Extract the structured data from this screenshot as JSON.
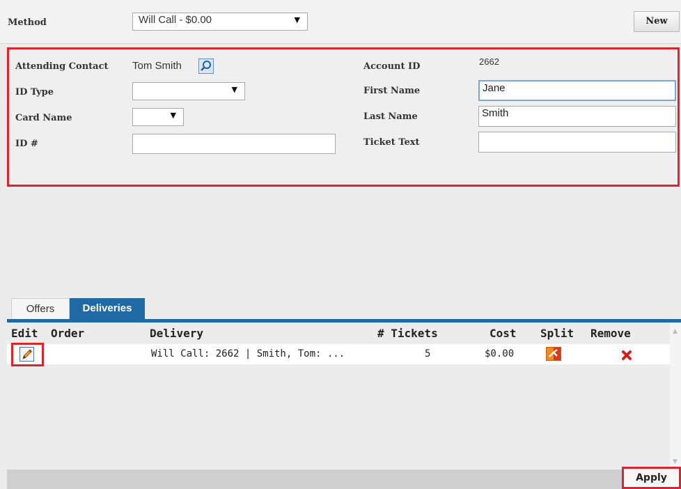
{
  "method_bar": {
    "label": "Method",
    "select_value": "Will Call - $0.00",
    "new_button": "New"
  },
  "contact": {
    "attending_contact_label": "Attending Contact",
    "attending_contact_value": "Tom Smith",
    "id_type_label": "ID Type",
    "id_type_value": "",
    "card_name_label": "Card Name",
    "card_name_value": "",
    "id_number_label": "ID #",
    "id_number_value": "",
    "account_id_label": "Account ID",
    "account_id_value": "2662",
    "first_name_label": "First Name",
    "first_name_value": "Jane",
    "last_name_label": "Last Name",
    "last_name_value": "Smith",
    "ticket_text_label": "Ticket Text",
    "ticket_text_value": ""
  },
  "tabs": [
    {
      "label": "Offers",
      "active": false
    },
    {
      "label": "Deliveries",
      "active": true
    }
  ],
  "grid": {
    "columns": [
      "Edit",
      "Order",
      "Delivery",
      "# Tickets",
      "Cost",
      "Split",
      "Remove"
    ],
    "rows": [
      {
        "order": "",
        "delivery": "Will Call: 2662 | Smith, Tom: ...",
        "tickets": "5",
        "cost": "$0.00"
      }
    ]
  },
  "footer": {
    "apply_button": "Apply"
  },
  "colors": {
    "highlight": "#d9252c",
    "tab_active": "#1f6aa5",
    "focus_border": "#7aa7d8"
  },
  "icons": [
    "dropdown-arrow-icon",
    "lookup-magnifier-icon",
    "edit-pencil-icon",
    "split-icon",
    "remove-x-icon",
    "scroll-up-icon",
    "scroll-down-icon"
  ]
}
